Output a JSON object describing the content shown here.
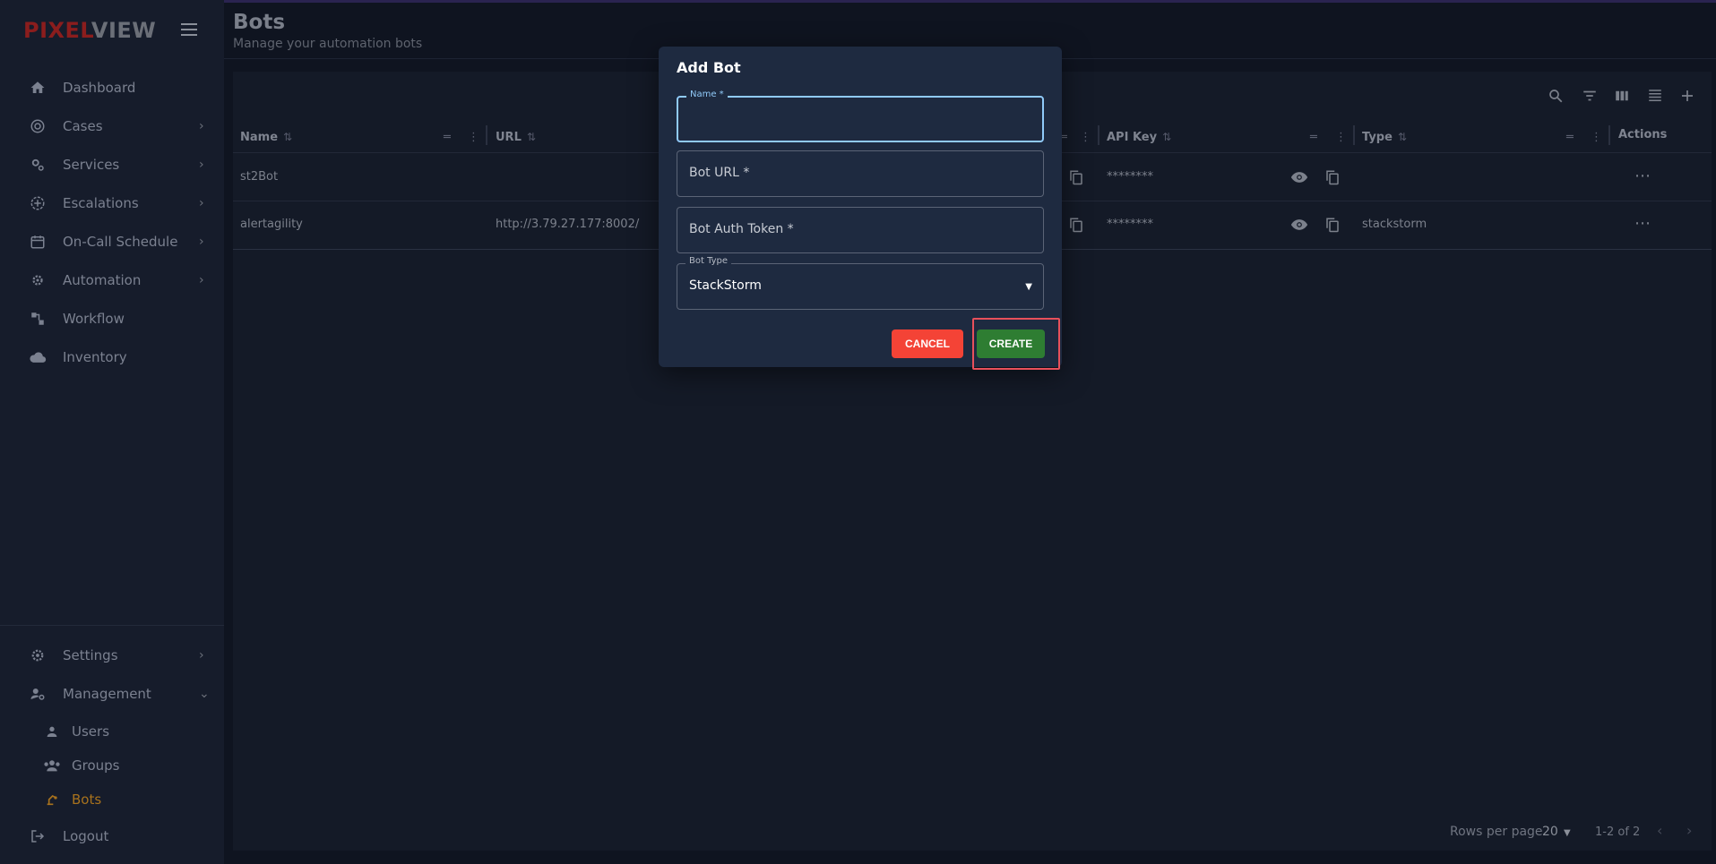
{
  "brand": {
    "part1": "PIXEL",
    "part2": "VIEW"
  },
  "sidebar": {
    "items": [
      {
        "label": "Dashboard",
        "icon": "home-icon",
        "chevron": false
      },
      {
        "label": "Cases",
        "icon": "target-icon",
        "chevron": true
      },
      {
        "label": "Services",
        "icon": "gears-icon",
        "chevron": true
      },
      {
        "label": "Escalations",
        "icon": "escalation-icon",
        "chevron": true
      },
      {
        "label": "On-Call Schedule",
        "icon": "calendar-icon",
        "chevron": true
      },
      {
        "label": "Automation",
        "icon": "gear-cog-icon",
        "chevron": true
      },
      {
        "label": "Workflow",
        "icon": "workflow-icon",
        "chevron": false
      },
      {
        "label": "Inventory",
        "icon": "cloud-icon",
        "chevron": false
      }
    ],
    "bottom": {
      "settings": "Settings",
      "management": "Management",
      "users": "Users",
      "groups": "Groups",
      "bots": "Bots",
      "logout": "Logout"
    }
  },
  "header": {
    "title": "Bots",
    "subtitle": "Manage your automation bots"
  },
  "table": {
    "columns": {
      "name": "Name",
      "url": "URL",
      "api_key": "API Key",
      "type": "Type",
      "actions": "Actions"
    },
    "rows": [
      {
        "name": "st2Bot",
        "url": "",
        "api_key": "********",
        "type": ""
      },
      {
        "name": "alertagility",
        "url": "http://3.79.27.177:8002/",
        "api_key": "********",
        "type": "stackstorm"
      }
    ]
  },
  "footer": {
    "rows_per_page_label": "Rows per page",
    "rows_per_page": "20",
    "range": "1-2 of 2"
  },
  "dialog": {
    "title": "Add Bot",
    "name_label": "Name *",
    "name_value": "",
    "bot_url_placeholder": "Bot URL *",
    "bot_auth_token_placeholder": "Bot Auth Token *",
    "bot_type_label": "Bot Type",
    "bot_type_value": "StackStorm",
    "cancel_label": "CANCEL",
    "create_label": "CREATE"
  },
  "colors": {
    "brand_red": "#8b1d1d",
    "active_nav": "#a8721d",
    "cancel": "#f44336",
    "create": "#2e7d32",
    "focus": "#90caf9",
    "highlight": "#e8505b"
  }
}
